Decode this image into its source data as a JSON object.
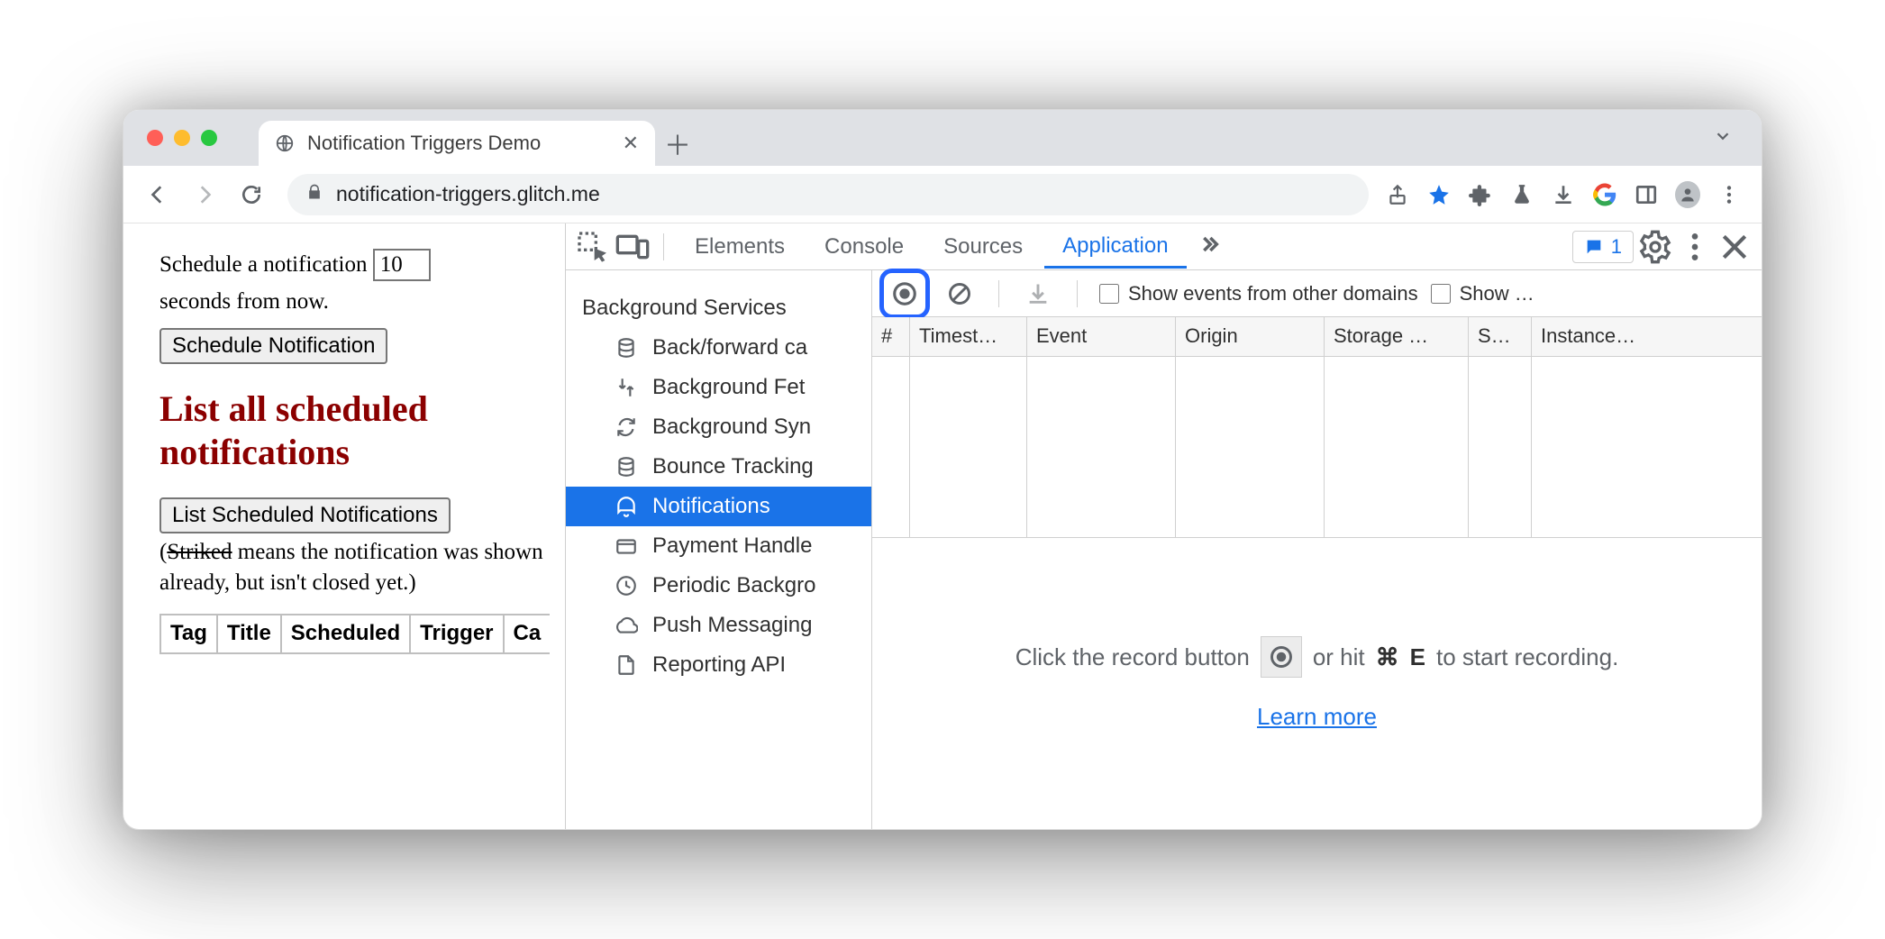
{
  "window": {
    "tab_title": "Notification Triggers Demo",
    "url": "notification-triggers.glitch.me"
  },
  "page": {
    "schedule_pre": "Schedule a notification",
    "schedule_value": "10",
    "schedule_post": "seconds from now.",
    "schedule_button": "Schedule Notification",
    "heading": "List all scheduled notifications",
    "list_button": "List Scheduled Notifications",
    "note_open": "(",
    "note_struck": "Striked",
    "note_rest": " means the notification was shown already, but isn't closed yet.)",
    "table_headers": [
      "Tag",
      "Title",
      "Scheduled",
      "Trigger",
      "Ca"
    ]
  },
  "devtools": {
    "tabs": [
      "Elements",
      "Console",
      "Sources",
      "Application"
    ],
    "active_tab": "Application",
    "issues_count": "1",
    "sidebar": {
      "group": "Background Services",
      "items": [
        "Back/forward ca",
        "Background Fet",
        "Background Syn",
        "Bounce Tracking",
        "Notifications",
        "Payment Handle",
        "Periodic Backgro",
        "Push Messaging",
        "Reporting API"
      ],
      "selected_index": 4
    },
    "toolbar": {
      "show_other_domains": "Show events from other domains",
      "show_trunc": "Show …"
    },
    "columns": [
      "#",
      "Timest…",
      "Event",
      "Origin",
      "Storage …",
      "S…",
      "Instance…"
    ],
    "empty": {
      "pre": "Click the record button",
      "mid": "or hit",
      "shortcut_sym": "⌘",
      "shortcut_key": "E",
      "post": "to start recording.",
      "learn_more": "Learn more"
    }
  }
}
